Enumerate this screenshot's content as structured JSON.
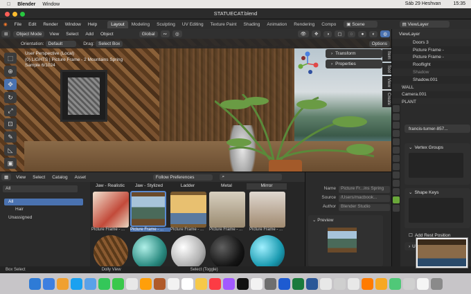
{
  "macbar": {
    "apple": "",
    "app": "Blender",
    "menu": [
      "Window"
    ],
    "date": "Sáb 29 Heshvan",
    "time": "15:35"
  },
  "window": {
    "title": "STATUECAT.blend"
  },
  "topmenu": [
    "File",
    "Edit",
    "Render",
    "Window",
    "Help"
  ],
  "workspaces": [
    "Layout",
    "Modeling",
    "Sculpting",
    "UV Editing",
    "Texture Paint",
    "Shading",
    "Animation",
    "Rendering",
    "Compo"
  ],
  "active_workspace": "Layout",
  "scene": {
    "label": "Scene",
    "view_layer": "ViewLayer"
  },
  "viewport_header": {
    "mode": "Object Mode",
    "view": "View",
    "select": "Select",
    "add": "Add",
    "object": "Object",
    "transform": "Global"
  },
  "viewport_header2": {
    "orientation_label": "Orientation:",
    "orientation": "Default",
    "drag_label": "Drag:",
    "drag": "Select Box",
    "options": "Options"
  },
  "viewport_info": {
    "line1": "User Perspective (Local)",
    "line2": "(0) LIGHTS | Picture Frame - 2 Mountains Spring",
    "line3": "Sample 6/1024"
  },
  "npanel": {
    "transform": "Transform",
    "properties": "Properties",
    "tabs": [
      "Item",
      "Tool",
      "View",
      "Create"
    ]
  },
  "outliner": {
    "rows": [
      "Doors 3",
      "Picture Frame -",
      "Picture Frame -",
      "Rooflight",
      "Shadow",
      "Shadow.001",
      "WALL",
      "Camera.001",
      "PLANT"
    ]
  },
  "properties": {
    "object": "francis-turner-857...",
    "vertex_groups": "Vertex Groups",
    "shape_keys": "Shape Keys",
    "add_rest": "Add Rest Position",
    "uv": "UV"
  },
  "asset_browser": {
    "menu": [
      "View",
      "Select",
      "Catalog",
      "Asset"
    ],
    "import": "Follow Preferences",
    "library": "All",
    "catalogs": [
      "All",
      "Hair",
      "Unassigned"
    ],
    "columns": [
      "Jaw - Realistic",
      "Jaw - Stylized",
      "Ladder",
      "Metal",
      "Mirror"
    ],
    "thumb_labels": [
      "Picture Frame - ...",
      "Picture Frame - ...",
      "Picture Frame - ...",
      "Picture Frame - ...",
      "Picture Frame - ..."
    ],
    "meta": {
      "name_label": "Name",
      "name": "Picture Fr...ins Spring",
      "source_label": "Source",
      "source": "/Users/macbook...",
      "author_label": "Author",
      "author": "Blender Studio"
    },
    "preview": "Preview"
  },
  "status": {
    "left": "Box Select",
    "mid": "Dolly View",
    "right": "Select (Toggle)"
  },
  "dock_colors": [
    "#2e7bd6",
    "#3d7fe0",
    "#f0a030",
    "#1aa1f0",
    "#5aa1e8",
    "#34c759",
    "#3ac84a",
    "#e8e8e8",
    "#ff9f0a",
    "#b05a2a",
    "#f2f2f2",
    "#ffffff",
    "#f7c948",
    "#fc3c44",
    "#a259ff",
    "#111111",
    "#f2f2f2",
    "#6e6e6e",
    "#1e5bd1",
    "#1a7a3c",
    "#2b5797",
    "#e8e8e8",
    "#cfcfcf",
    "#e8e8e8",
    "#ff7b00",
    "#f7a823",
    "#50c878",
    "#d0d0d0",
    "#f5f5f5",
    "#8a8a8a"
  ]
}
